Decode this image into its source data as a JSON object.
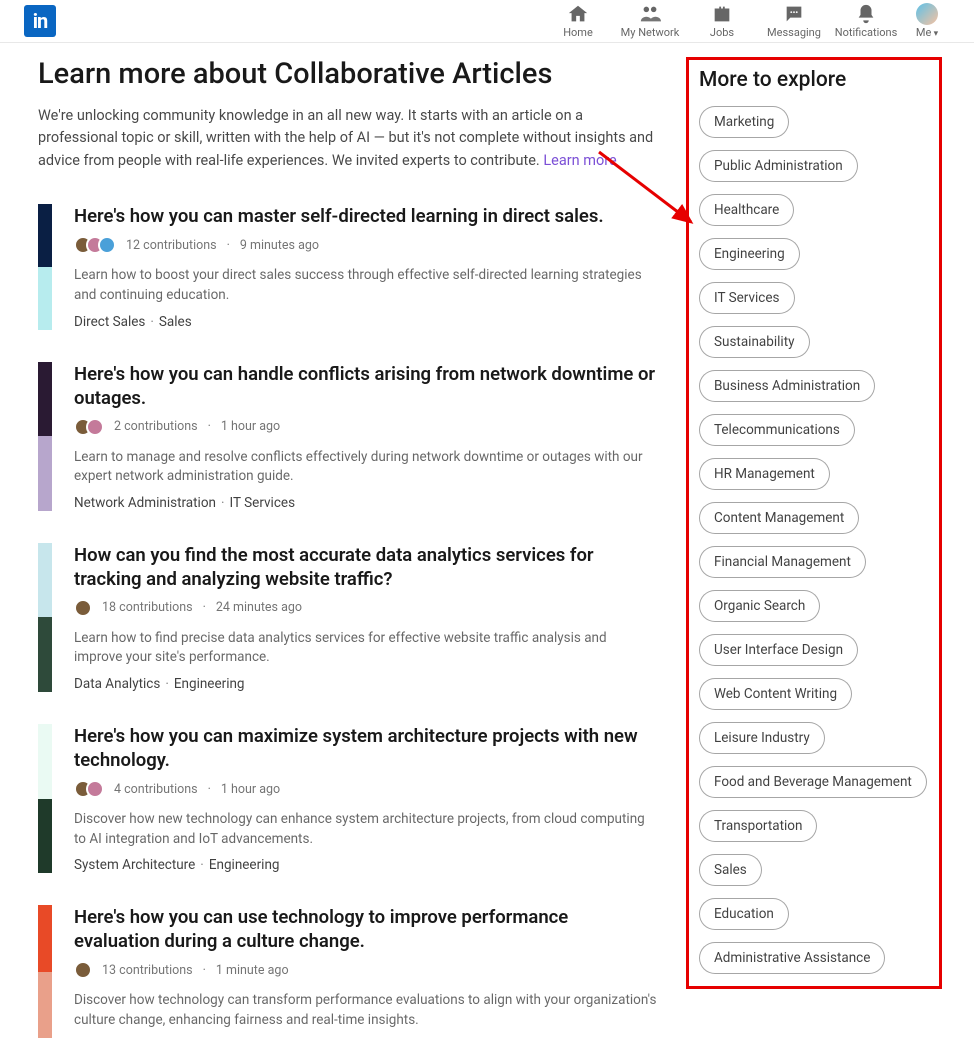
{
  "nav": {
    "home": "Home",
    "network": "My Network",
    "jobs": "Jobs",
    "messaging": "Messaging",
    "notifications": "Notifications",
    "me": "Me"
  },
  "header": {
    "title": "Learn more about Collaborative Articles",
    "desc": "We're unlocking community knowledge in an all new way. It starts with an article on a professional topic or skill, written with the help of AI — but it's not complete without insights and advice from people with real-life experiences. We invited experts to contribute. ",
    "learn_more": "Learn more"
  },
  "articles": [
    {
      "title": "Here's how you can master self-directed learning in direct sales.",
      "contributions": "12 contributions",
      "time": "9 minutes ago",
      "desc": "Learn how to boost your direct sales success through effective self-directed learning strategies and continuing education.",
      "tag1": "Direct Sales",
      "tag2": "Sales",
      "thumb_top": "#0a1f44",
      "thumb_bot": "#b7ecee",
      "avatars": 3
    },
    {
      "title": "Here's how you can handle conflicts arising from network downtime or outages.",
      "contributions": "2 contributions",
      "time": "1 hour ago",
      "desc": "Learn to manage and resolve conflicts effectively during network downtime or outages with our expert network administration guide.",
      "tag1": "Network Administration",
      "tag2": "IT Services",
      "thumb_top": "#2a1a33",
      "thumb_bot": "#b7a6cc",
      "avatars": 2
    },
    {
      "title": "How can you find the most accurate data analytics services for tracking and analyzing website traffic?",
      "contributions": "18 contributions",
      "time": "24 minutes ago",
      "desc": "Learn how to find precise data analytics services for effective website traffic analysis and improve your site's performance.",
      "tag1": "Data Analytics",
      "tag2": "Engineering",
      "thumb_top": "#c7e6ec",
      "thumb_bot": "#2e4a3a",
      "avatars": 1
    },
    {
      "title": "Here's how you can maximize system architecture projects with new technology.",
      "contributions": "4 contributions",
      "time": "1 hour ago",
      "desc": "Discover how new technology can enhance system architecture projects, from cloud computing to AI integration and IoT advancements.",
      "tag1": "System Architecture",
      "tag2": "Engineering",
      "thumb_top": "#eafaf3",
      "thumb_bot": "#1f3a2a",
      "avatars": 2
    },
    {
      "title": "Here's how you can use technology to improve performance evaluation during a culture change.",
      "contributions": "13 contributions",
      "time": "1 minute ago",
      "desc": "Discover how technology can transform performance evaluations to align with your organization's culture change, enhancing fairness and real-time insights.",
      "tag1": "",
      "tag2": "",
      "thumb_top": "#e84a27",
      "thumb_bot": "#e9a08a",
      "avatars": 1
    }
  ],
  "sidebar": {
    "title": "More to explore",
    "chips": [
      "Marketing",
      "Public Administration",
      "Healthcare",
      "Engineering",
      "IT Services",
      "Sustainability",
      "Business Administration",
      "Telecommunications",
      "HR Management",
      "Content Management",
      "Financial Management",
      "Organic Search",
      "User Interface Design",
      "Web Content Writing",
      "Leisure Industry",
      "Food and Beverage Management",
      "Transportation",
      "Sales",
      "Education",
      "Administrative Assistance"
    ]
  }
}
